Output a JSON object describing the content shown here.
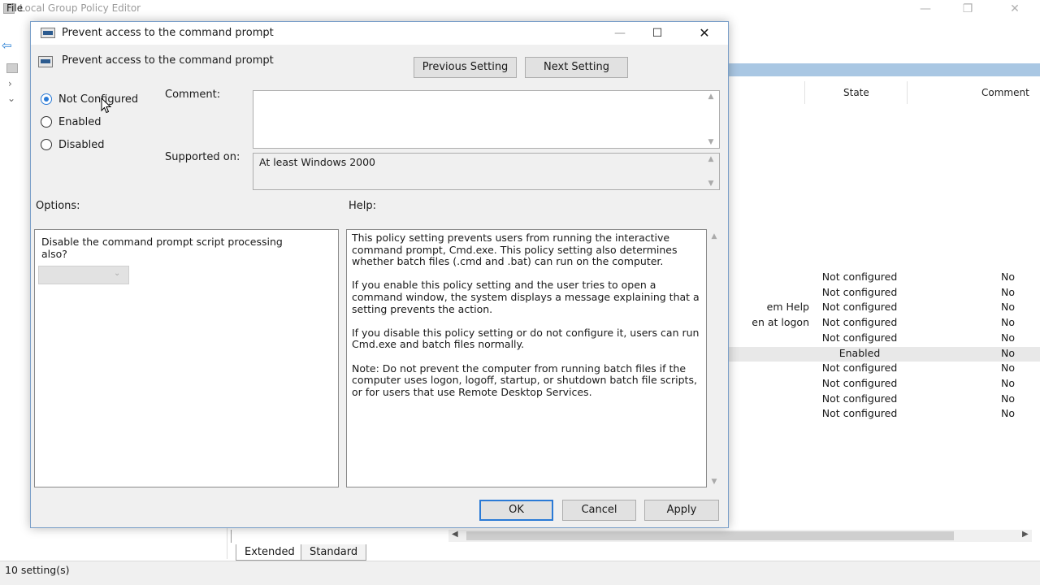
{
  "main_window": {
    "title": "Local Group Policy Editor",
    "menu_file": "File",
    "controls": {
      "minimize": "—",
      "maximize": "❐",
      "close": "✕"
    },
    "list": {
      "columns": {
        "state": "State",
        "comment": "Comment"
      },
      "rows": [
        {
          "name": "",
          "state": "Not configured",
          "comment": "No",
          "selected": false
        },
        {
          "name": "",
          "state": "Not configured",
          "comment": "No",
          "selected": false
        },
        {
          "name": "em Help",
          "state": "Not configured",
          "comment": "No",
          "selected": false
        },
        {
          "name": "en at logon",
          "state": "Not configured",
          "comment": "No",
          "selected": false
        },
        {
          "name": "",
          "state": "Not configured",
          "comment": "No",
          "selected": false
        },
        {
          "name": "",
          "state": "Enabled",
          "comment": "No",
          "selected": true
        },
        {
          "name": "",
          "state": "Not configured",
          "comment": "No",
          "selected": false
        },
        {
          "name": "",
          "state": "Not configured",
          "comment": "No",
          "selected": false
        },
        {
          "name": "",
          "state": "Not configured",
          "comment": "No",
          "selected": false
        },
        {
          "name": "",
          "state": "Not configured",
          "comment": "No",
          "selected": false
        }
      ]
    },
    "tabs": {
      "extended": "Extended",
      "standard": "Standard"
    },
    "status": "10 setting(s)"
  },
  "dialog": {
    "title": "Prevent access to the command prompt",
    "controls": {
      "minimize": "—",
      "maximize": "☐",
      "close": "✕"
    },
    "policy_name": "Prevent access to the command prompt",
    "previous_setting": "Previous Setting",
    "next_setting": "Next Setting",
    "radios": {
      "not_configured": "Not Configured",
      "enabled": "Enabled",
      "disabled": "Disabled",
      "selected": "not_configured"
    },
    "comment_label": "Comment:",
    "comment_value": "",
    "supported_label": "Supported on:",
    "supported_value": "At least Windows 2000",
    "options_label": "Options:",
    "help_label": "Help:",
    "options_text": "Disable the command prompt script processing also?",
    "help_paragraphs": [
      "This policy setting prevents users from running the interactive command prompt, Cmd.exe.  This policy setting also determines whether batch files (.cmd and .bat) can run on the computer.",
      "If you enable this policy setting and the user tries to open a command window, the system displays a message explaining that a setting prevents the action.",
      "If you disable this policy setting or do not configure it, users can run Cmd.exe and batch files normally.",
      "Note: Do not prevent the computer from running batch files if the computer uses logon, logoff, startup, or shutdown batch file scripts, or for users that use Remote Desktop Services."
    ],
    "ok": "OK",
    "cancel": "Cancel",
    "apply": "Apply"
  },
  "colors": {
    "accent": "#2a7ad6",
    "dialog_bg": "#f0f0f0",
    "selection_bg": "#e8e8e8",
    "header_strip": "#a9c7e3"
  },
  "icons": {
    "app": "policy-editor-icon",
    "back": "back-arrow-icon",
    "policy": "policy-setting-icon",
    "cursor": "mouse-pointer-icon"
  }
}
